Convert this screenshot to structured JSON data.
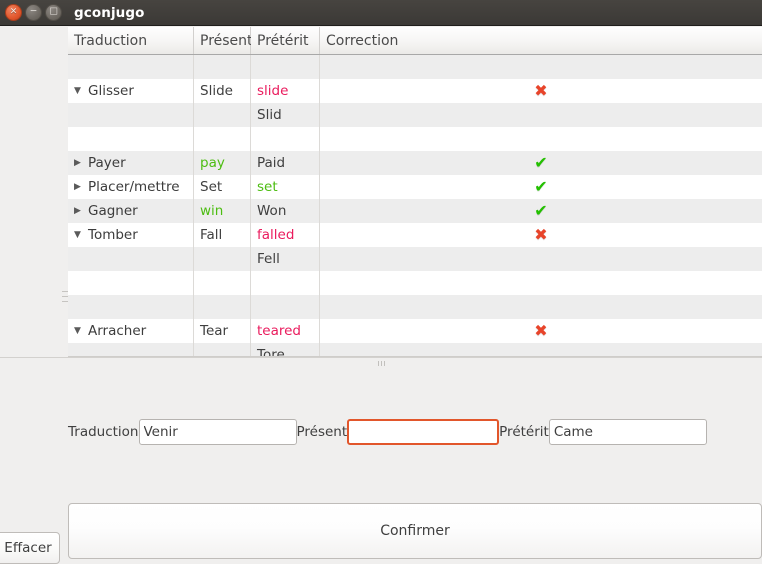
{
  "window": {
    "title": "gconjugo",
    "controls": [
      {
        "name": "close",
        "glyph": "×"
      },
      {
        "name": "minimize",
        "glyph": "−"
      },
      {
        "name": "maximize",
        "glyph": "□"
      }
    ]
  },
  "table": {
    "columns": [
      "Traduction",
      "Présent",
      "Prétérit",
      "Correction"
    ],
    "rows": [
      {
        "expander": "",
        "traduction": "",
        "present": "",
        "preterit": "",
        "present_state": "norm",
        "preterit_state": "norm",
        "mark": ""
      },
      {
        "expander": "▼",
        "traduction": "Glisser",
        "present": "Slide",
        "preterit": "slide",
        "present_state": "norm",
        "preterit_state": "bad",
        "mark": "x"
      },
      {
        "expander": "",
        "traduction": "",
        "present": "",
        "preterit": "Slid",
        "present_state": "norm",
        "preterit_state": "norm",
        "mark": ""
      },
      {
        "expander": "",
        "traduction": "",
        "present": "",
        "preterit": "",
        "present_state": "norm",
        "preterit_state": "norm",
        "mark": ""
      },
      {
        "expander": "▶",
        "traduction": "Payer",
        "present": "pay",
        "preterit": "Paid",
        "present_state": "ok",
        "preterit_state": "norm",
        "mark": "v"
      },
      {
        "expander": "▶",
        "traduction": "Placer/mettre",
        "present": "Set",
        "preterit": "set",
        "present_state": "norm",
        "preterit_state": "ok",
        "mark": "v"
      },
      {
        "expander": "▶",
        "traduction": "Gagner",
        "present": "win",
        "preterit": "Won",
        "present_state": "ok",
        "preterit_state": "norm",
        "mark": "v"
      },
      {
        "expander": "▼",
        "traduction": "Tomber",
        "present": "Fall",
        "preterit": "falled",
        "present_state": "norm",
        "preterit_state": "bad",
        "mark": "x"
      },
      {
        "expander": "",
        "traduction": "",
        "present": "",
        "preterit": "Fell",
        "present_state": "norm",
        "preterit_state": "norm",
        "mark": ""
      },
      {
        "expander": "",
        "traduction": "",
        "present": "",
        "preterit": "",
        "present_state": "norm",
        "preterit_state": "norm",
        "mark": ""
      },
      {
        "expander": "",
        "traduction": "",
        "present": "",
        "preterit": "",
        "present_state": "norm",
        "preterit_state": "norm",
        "mark": ""
      },
      {
        "expander": "▼",
        "traduction": "Arracher",
        "present": "Tear",
        "preterit": "teared",
        "present_state": "norm",
        "preterit_state": "bad",
        "mark": "x"
      },
      {
        "expander": "",
        "traduction": "",
        "present": "",
        "preterit": "Tore",
        "present_state": "norm",
        "preterit_state": "norm",
        "mark": ""
      },
      {
        "expander": "",
        "traduction": "",
        "present": "",
        "preterit": "",
        "present_state": "norm",
        "preterit_state": "norm",
        "mark": ""
      }
    ],
    "marks": {
      "x": "✖",
      "v": "✔"
    }
  },
  "form": {
    "traduction_label": "Traduction",
    "traduction_value": "Venir",
    "present_label": "Présent",
    "present_value": "",
    "preterit_label": "Prétérit",
    "preterit_value": "Came"
  },
  "buttons": {
    "confirm": "Confirmer",
    "clear": "Effacer"
  },
  "colors": {
    "correct": "#4dbd12",
    "incorrect": "#ea1b5d",
    "focus": "#e2562b",
    "titlebar": "#3c3b37",
    "mark_x": "#e8442a",
    "mark_v": "#23c000"
  }
}
